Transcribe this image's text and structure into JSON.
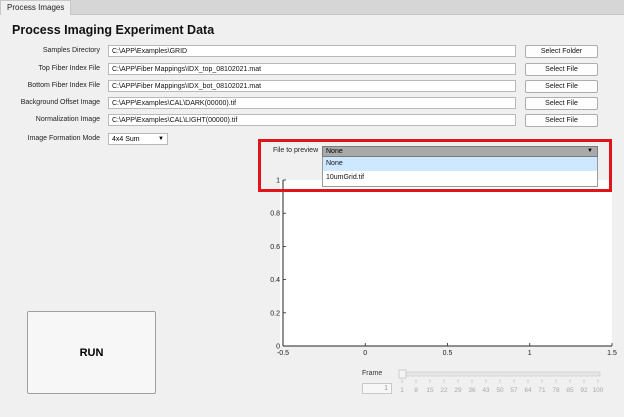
{
  "tab": {
    "label": "Process Images"
  },
  "title": "Process Imaging Experiment Data",
  "rows": [
    {
      "label": "Samples Directory",
      "value": "C:\\APP\\Examples\\GRID",
      "button": "Select Folder"
    },
    {
      "label": "Top Fiber Index File",
      "value": "C:\\APP\\Fiber Mappings\\IDX_top_08102021.mat",
      "button": "Select File"
    },
    {
      "label": "Bottom Fiber Index File",
      "value": "C:\\APP\\Fiber Mappings\\IDX_bot_08102021.mat",
      "button": "Select File"
    },
    {
      "label": "Background Offset Image",
      "value": "C:\\APP\\Examples\\CAL\\DARK(00000).tif",
      "button": "Select File"
    },
    {
      "label": "Normalization Image",
      "value": "C:\\APP\\Examples\\CAL\\LIGHT(00000).tif",
      "button": "Select File"
    }
  ],
  "mode": {
    "label": "Image Formation Mode",
    "value": "4x4 Sum"
  },
  "preview": {
    "label": "File to preview",
    "selected": "None",
    "options": [
      "None",
      "10umGrid.tif"
    ]
  },
  "run_label": "RUN",
  "plot": {
    "x_ticks": [
      "-0.5",
      "0",
      "0.5",
      "1",
      "1.5"
    ],
    "y_ticks": [
      "0",
      "0.2",
      "0.4",
      "0.6",
      "0.8",
      "1"
    ],
    "xlim": [
      -0.5,
      1.5
    ],
    "ylim": [
      0,
      1
    ]
  },
  "frame": {
    "label": "Frame",
    "value": "1",
    "ticks": [
      "1",
      "8",
      "15",
      "22",
      "29",
      "36",
      "43",
      "50",
      "57",
      "64",
      "71",
      "78",
      "85",
      "92",
      "100"
    ]
  }
}
